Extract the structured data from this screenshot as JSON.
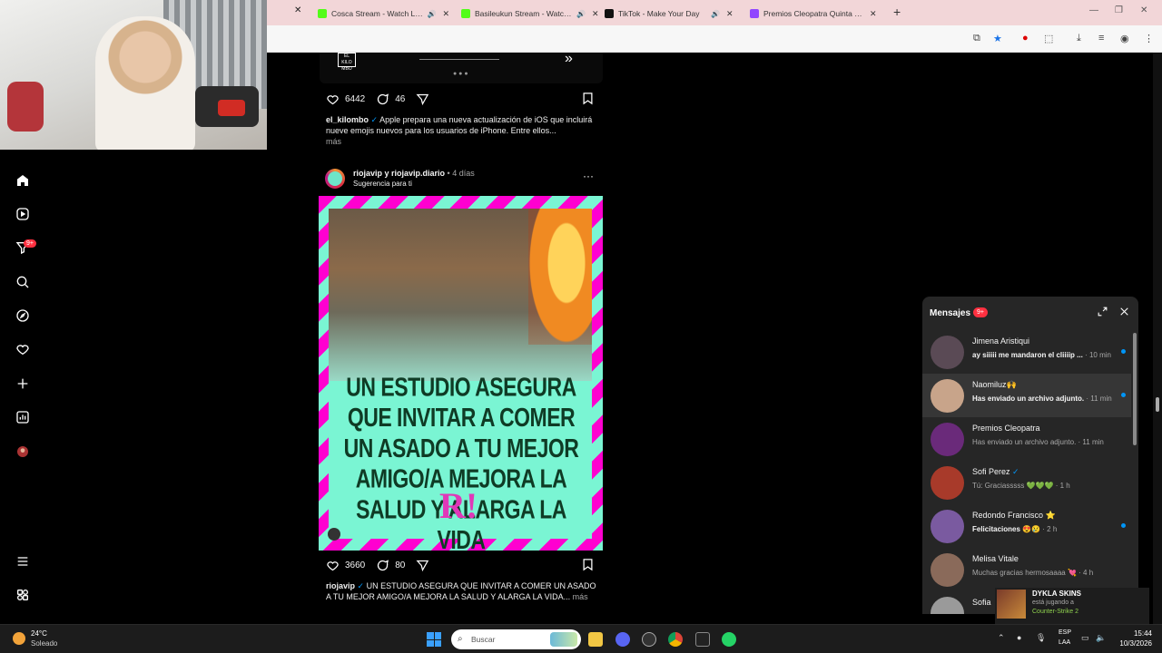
{
  "browser": {
    "tabs": [
      {
        "title": "Cosca Stream - Watch Live",
        "favicon_color": "#53fc18",
        "has_audio": true
      },
      {
        "title": "Basileukun Stream - Watch Live o",
        "favicon_color": "#53fc18",
        "has_audio": true
      },
      {
        "title": "TikTok - Make Your Day",
        "favicon_color": "#111111",
        "has_audio": true
      },
      {
        "title": "Premios Cleopatra Quinta Edici",
        "favicon_color": "#9146ff",
        "has_audio": false
      }
    ],
    "active_tab_close": "✕",
    "new_tab": "+"
  },
  "nav": {
    "items": [
      "home-icon",
      "reels-icon",
      "filter-icon",
      "search-icon",
      "explore-icon",
      "heart-icon",
      "create-icon",
      "dashboard-icon",
      "profile-avatar"
    ],
    "notif_badge": "9+",
    "bottom": [
      "menu-icon",
      "threads-icon"
    ]
  },
  "post1": {
    "likes": "6442",
    "comments": "46",
    "username": "el_kilombo",
    "caption": "Apple prepara una nueva actualización de iOS que incluirá nueve emojis nuevos para los usuarios de iPhone. Entre ellos...",
    "more": "más"
  },
  "post2": {
    "username": "riojavip y riojavip.diario",
    "age": "• 4 días",
    "suggestion": "Sugerencia para ti",
    "options": "···",
    "headline": "UN ESTUDIO ASEGURA QUE INVITAR A COMER UN ASADO A TU MEJOR AMIGO/A MEJORA LA SALUD Y ALARGA LA VIDA",
    "logo": "R!",
    "likes": "3660",
    "comments": "80",
    "caption_user": "riojavip",
    "caption": "UN ESTUDIO ASEGURA QUE INVITAR A COMER UN ASADO A TU MEJOR AMIGO/A MEJORA LA SALUD Y ALARGA LA VIDA...",
    "more": "más"
  },
  "messages": {
    "title": "Mensajes",
    "badge": "9+",
    "items": [
      {
        "name": "Jimena Aristiqui",
        "preview": "ay siiiii me mandaron el cliiiip ...",
        "time": "· 10 min",
        "unread": true,
        "avatar_color": "#5a4a55"
      },
      {
        "name": "Naomiluz🙌",
        "preview": "Has enviado un archivo adjunto.",
        "time": "· 11 min",
        "unread": true,
        "avatar_color": "#c8a48a"
      },
      {
        "name": "Premios Cleopatra",
        "preview": "Has enviado un archivo adjunto.",
        "time": "· 11 min",
        "unread": false,
        "avatar_color": "#6a2a7a"
      },
      {
        "name": "Sofi Perez",
        "preview": "Tú: Graciasssss 💚💚💚",
        "time": "· 1 h",
        "unread": false,
        "avatar_color": "#a83a2a"
      },
      {
        "name": "Redondo Francisco ⭐",
        "preview": "Felicitaciones 😍😢",
        "time": "· 2 h",
        "unread": true,
        "avatar_color": "#7a5aa0"
      },
      {
        "name": "Melisa Vitale",
        "preview": "Muchas gracias hermosaaaa 💘",
        "time": "· 4 h",
        "unread": false,
        "avatar_color": "#8a6a5a"
      },
      {
        "name": "Sofia",
        "preview": "",
        "time": "",
        "unread": false,
        "avatar_color": "#9a9a9a"
      }
    ]
  },
  "game_notification": {
    "name": "DYKLA SKINS",
    "status": "está jugando a",
    "game": "Counter-Strike 2"
  },
  "taskbar": {
    "temp": "24°C",
    "condition": "Soleado",
    "search_placeholder": "Buscar",
    "lang1": "ESP",
    "lang2": "LAA",
    "time": "15:44",
    "date": "10/3/2026"
  }
}
